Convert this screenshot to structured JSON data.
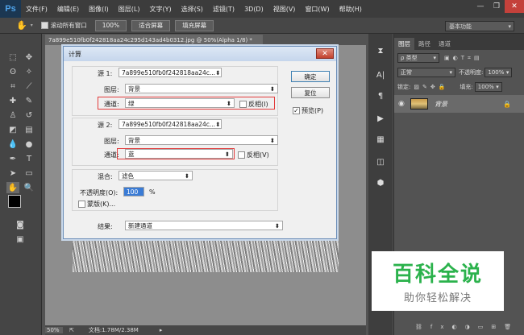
{
  "menubar": {
    "logo": "Ps",
    "items": [
      "文件(F)",
      "编辑(E)",
      "图像(I)",
      "图层(L)",
      "文字(Y)",
      "选择(S)",
      "滤镜(T)",
      "3D(D)",
      "视图(V)",
      "窗口(W)",
      "帮助(H)"
    ]
  },
  "options": {
    "scroll_all": "滚动所有窗口",
    "zoom": "100%",
    "fit_screen": "适合屏幕",
    "fill_screen": "填充屏幕",
    "workspace": "基本功能"
  },
  "document": {
    "tab": "7a899e510fb0f242818aa24c295d143ad4b0312.jpg @ 50%(Alpha 1/8) *",
    "zoom": "50%",
    "doc_size": "文档:1.78M/2.38M"
  },
  "dialog": {
    "title": "计算",
    "source1": {
      "label": "源 1:",
      "file": "7a899e510fb0f242818aa24c...",
      "layer_label": "图层:",
      "layer": "背景",
      "channel_label": "通道:",
      "channel": "绿",
      "invert": "反相(I)"
    },
    "source2": {
      "label": "源 2:",
      "file": "7a899e510fb0f242818aa24c...",
      "layer_label": "图层:",
      "layer": "背景",
      "channel_label": "通道:",
      "channel": "蓝",
      "invert": "反相(V)"
    },
    "blending_label": "混合:",
    "blending": "滤色",
    "opacity_label": "不透明度(O):",
    "opacity": "100",
    "opacity_unit": "%",
    "mask": "蒙版(K)...",
    "result_label": "结果:",
    "result": "新建通道",
    "ok": "确定",
    "reset": "复位",
    "preview": "预览(P)"
  },
  "layers_panel": {
    "tabs": [
      "图层",
      "路径",
      "通道"
    ],
    "kind": "ρ 类型",
    "blend": "正常",
    "opacity_label": "不透明度:",
    "opacity": "100%",
    "lock_label": "锁定:",
    "fill_label": "填充:",
    "fill": "100%",
    "layer_name": "背景"
  },
  "watermark": {
    "title": "百科全说",
    "subtitle": "助你轻松解决"
  }
}
